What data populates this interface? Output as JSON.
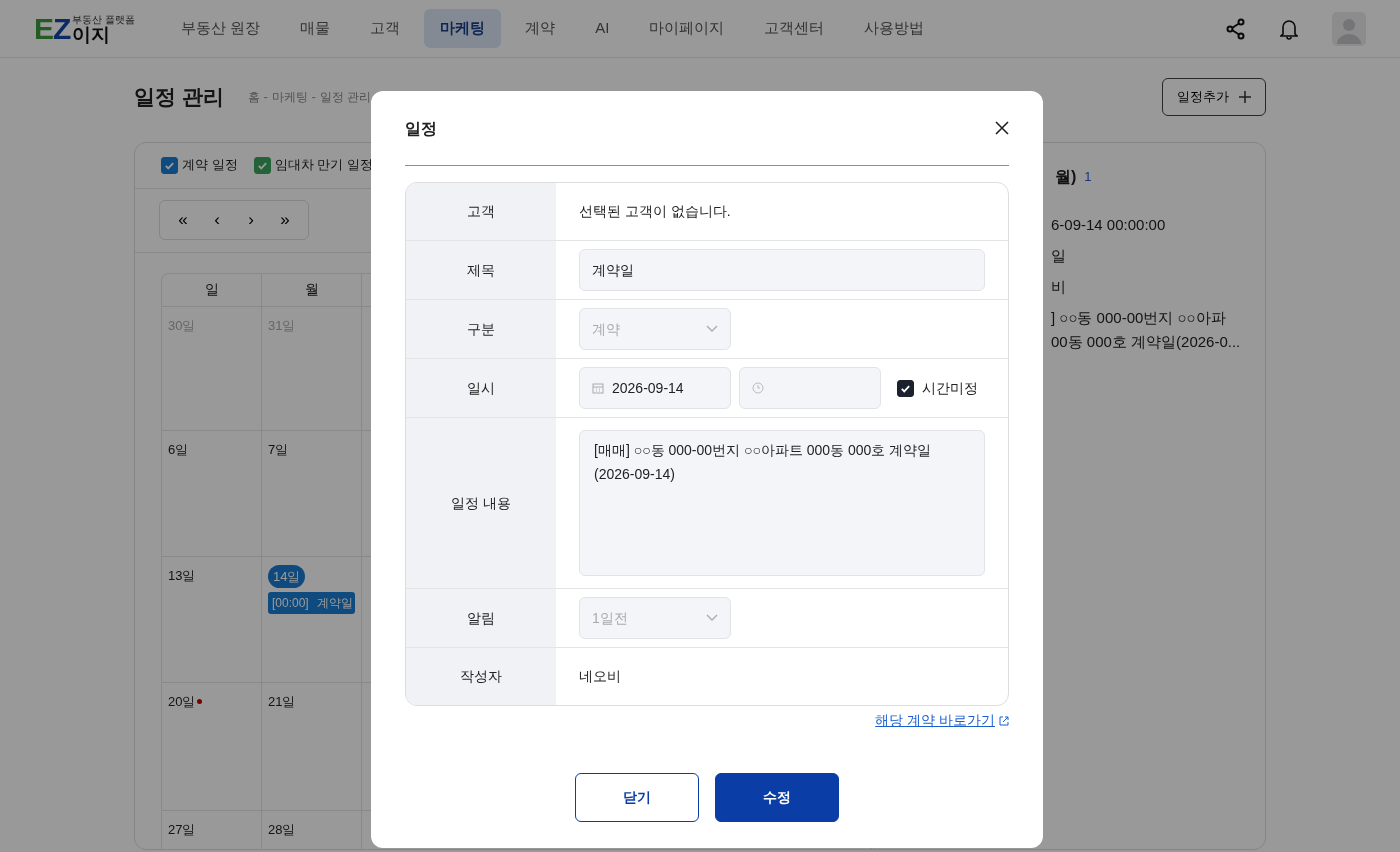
{
  "header": {
    "logo": {
      "tagline": "부동산 플랫폼",
      "latin": "EZ",
      "korean": "이지"
    },
    "nav": [
      {
        "label": "부동산 원장",
        "selected": false
      },
      {
        "label": "매물",
        "selected": false
      },
      {
        "label": "고객",
        "selected": false
      },
      {
        "label": "마케팅",
        "selected": true
      },
      {
        "label": "계약",
        "selected": false
      },
      {
        "label": "AI",
        "selected": false
      },
      {
        "label": "마이페이지",
        "selected": false
      },
      {
        "label": "고객센터",
        "selected": false
      },
      {
        "label": "사용방법",
        "selected": false
      }
    ]
  },
  "page": {
    "title": "일정 관리",
    "breadcrumb": [
      "홈",
      "-",
      "마케팅",
      "-",
      "일정 관리"
    ],
    "add_button": "일정추가"
  },
  "filters": [
    {
      "label": "계약 일정",
      "checked": true,
      "color": "#0f4b7e"
    },
    {
      "label": "임대차 만기 일정",
      "checked": true,
      "color": "#246339"
    }
  ],
  "calendar": {
    "nav_buttons": [
      "«",
      "‹",
      "›",
      "»"
    ],
    "weekdays": [
      "일",
      "월"
    ],
    "weeks": [
      [
        {
          "day": "30일",
          "muted": true,
          "today": false,
          "dot": false
        },
        {
          "day": "31일",
          "muted": true,
          "today": false,
          "dot": false
        }
      ],
      [
        {
          "day": "6일",
          "muted": false,
          "today": false,
          "dot": false
        },
        {
          "day": "7일",
          "muted": false,
          "today": false,
          "dot": false
        }
      ],
      [
        {
          "day": "13일",
          "muted": false,
          "today": false,
          "dot": false
        },
        {
          "day": "14일",
          "muted": false,
          "today": true,
          "dot": false,
          "events": [
            {
              "time": "[00:00]",
              "title": "계약일",
              "color": "#0f4b7e"
            }
          ]
        }
      ],
      [
        {
          "day": "20일",
          "muted": false,
          "today": false,
          "dot": true
        },
        {
          "day": "21일",
          "muted": false,
          "today": false,
          "dot": false
        }
      ],
      [
        {
          "day": "27일",
          "muted": false,
          "today": false,
          "dot": false
        },
        {
          "day": "28일",
          "muted": false,
          "today": false,
          "dot": false
        }
      ]
    ]
  },
  "side_panel": {
    "heading": "월)",
    "count": "1",
    "lines": [
      "6-09-14 00:00:00",
      "일",
      "비",
      "] ○○동 000-00번지 ○○아파\n00동 000호 계약일(2026-0..."
    ]
  },
  "modal": {
    "title": "일정",
    "rows": [
      {
        "kind": "text",
        "label": "고객",
        "value": "선택된 고객이 없습니다."
      },
      {
        "kind": "input",
        "label": "제목",
        "value": "계약일"
      },
      {
        "kind": "select",
        "label": "구분",
        "value": "계약",
        "disabled": true
      },
      {
        "kind": "datetime",
        "label": "일시",
        "date": "2026-09-14",
        "untimed": {
          "label": "시간미정",
          "checked": true
        }
      },
      {
        "kind": "textarea",
        "label": "일정 내용",
        "value": "[매매] ○○동 000-00번지 ○○아파트 000동 000호 계약일(2026-09-14)"
      },
      {
        "kind": "select",
        "label": "알림",
        "value": "1일전",
        "disabled": true
      },
      {
        "kind": "text",
        "label": "작성자",
        "value": "네오비"
      }
    ],
    "link": "해당 계약 바로가기",
    "buttons": [
      {
        "label": "닫기",
        "kind": "secondary"
      },
      {
        "label": "수정",
        "kind": "primary"
      }
    ]
  }
}
